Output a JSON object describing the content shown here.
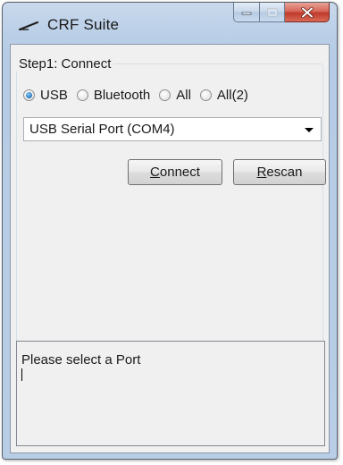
{
  "window": {
    "title": "CRF Suite"
  },
  "caption_buttons": {
    "minimize_icon": "minimize-icon",
    "maximize_icon": "maximize-icon",
    "close_glyph": "X"
  },
  "step1": {
    "legend": "Step1: Connect",
    "radios": [
      {
        "label": "USB",
        "checked": true
      },
      {
        "label": "Bluetooth",
        "checked": false
      },
      {
        "label": "All",
        "checked": false
      },
      {
        "label": "All(2)",
        "checked": false
      }
    ],
    "port_select": {
      "selected": "USB Serial Port (COM4)"
    },
    "connect_button": {
      "mnemonic": "C",
      "rest": "onnect"
    },
    "rescan_button": {
      "mnemonic": "R",
      "rest": "escan"
    }
  },
  "log": {
    "text": "Please select a Port"
  },
  "colors": {
    "accent": "#2f7fc4",
    "close_button": "#c0392b",
    "client_bg": "#f0f0f0"
  }
}
